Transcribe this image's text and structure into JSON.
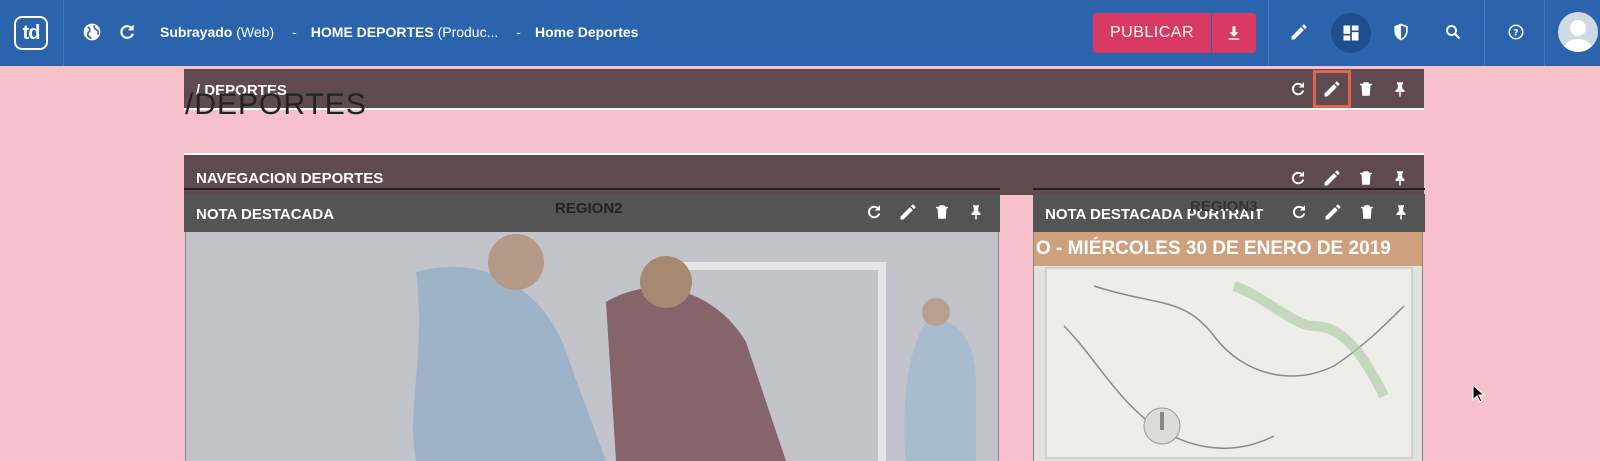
{
  "app": {
    "logo": "td"
  },
  "breadcrumbs": [
    {
      "bold": "Subrayado",
      "rest": " (Web)"
    },
    {
      "bold": "HOME DEPORTES",
      "rest": " (Produc..."
    },
    {
      "bold": "Home Deportes",
      "rest": ""
    }
  ],
  "breadcrumb_separator": "-",
  "toolbar": {
    "publish_label": "PUBLICAR"
  },
  "blocks": {
    "deportes_title_bar": "/ DEPORTES",
    "deportes_heading": "/DEPORTES",
    "navegacion_bar": "NAVEGACION DEPORTES",
    "region2": "REGION2",
    "region3": "REGION3",
    "nota_destacada": "NOTA DESTACADA",
    "nota_destacada_portrait": "NOTA DESTACADA PORTRAIT"
  },
  "portrait_image_text": "O - MIÉRCOLES 30 DE ENERO DE 2019",
  "colors": {
    "topbar": "#2b64ad",
    "accent": "#d93a63",
    "background": "#f6c1ca",
    "block_bar": "#5f4b4f",
    "highlight": "#e3654f"
  }
}
